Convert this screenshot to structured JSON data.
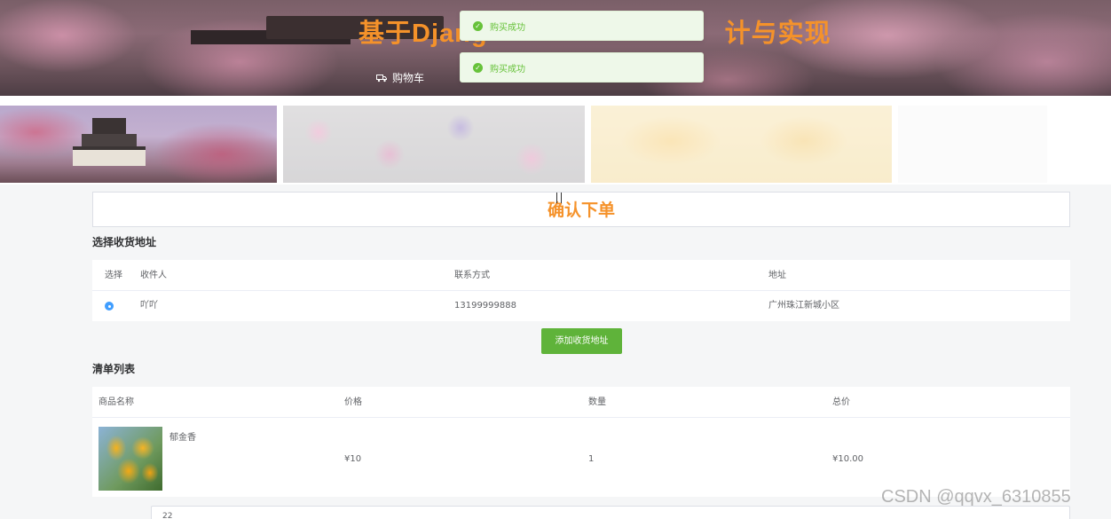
{
  "header": {
    "title": "基于Djang",
    "title_tail": "计与实现",
    "nav": {
      "cart_label": "购物车",
      "cart_icon": "truck-icon"
    }
  },
  "toasts": [
    {
      "text": "购买成功",
      "icon": "check-circle-icon",
      "color": "#67c23a"
    },
    {
      "text": "购买成功",
      "icon": "check-circle-icon",
      "color": "#67c23a"
    }
  ],
  "page": {
    "heading": "确认下单",
    "accent": "#f5922a"
  },
  "address": {
    "section_title": "选择收货地址",
    "columns": [
      "选择",
      "收件人",
      "联系方式",
      "地址"
    ],
    "rows": [
      {
        "selected": true,
        "recipient": "吖吖",
        "phone": "13199999888",
        "address": "广州珠江新城小区"
      }
    ],
    "add_button": "添加收货地址"
  },
  "order": {
    "section_title": "清单列表",
    "columns": [
      "商品名称",
      "价格",
      "数量",
      "总价"
    ],
    "items": [
      {
        "name": "郁金香",
        "price": "¥10",
        "quantity": "1",
        "total": "¥10.00"
      }
    ]
  },
  "note": {
    "value": "22"
  },
  "watermark": "CSDN @qqvx_6310855",
  "colors": {
    "primary": "#409eff",
    "success": "#5fb33a"
  }
}
